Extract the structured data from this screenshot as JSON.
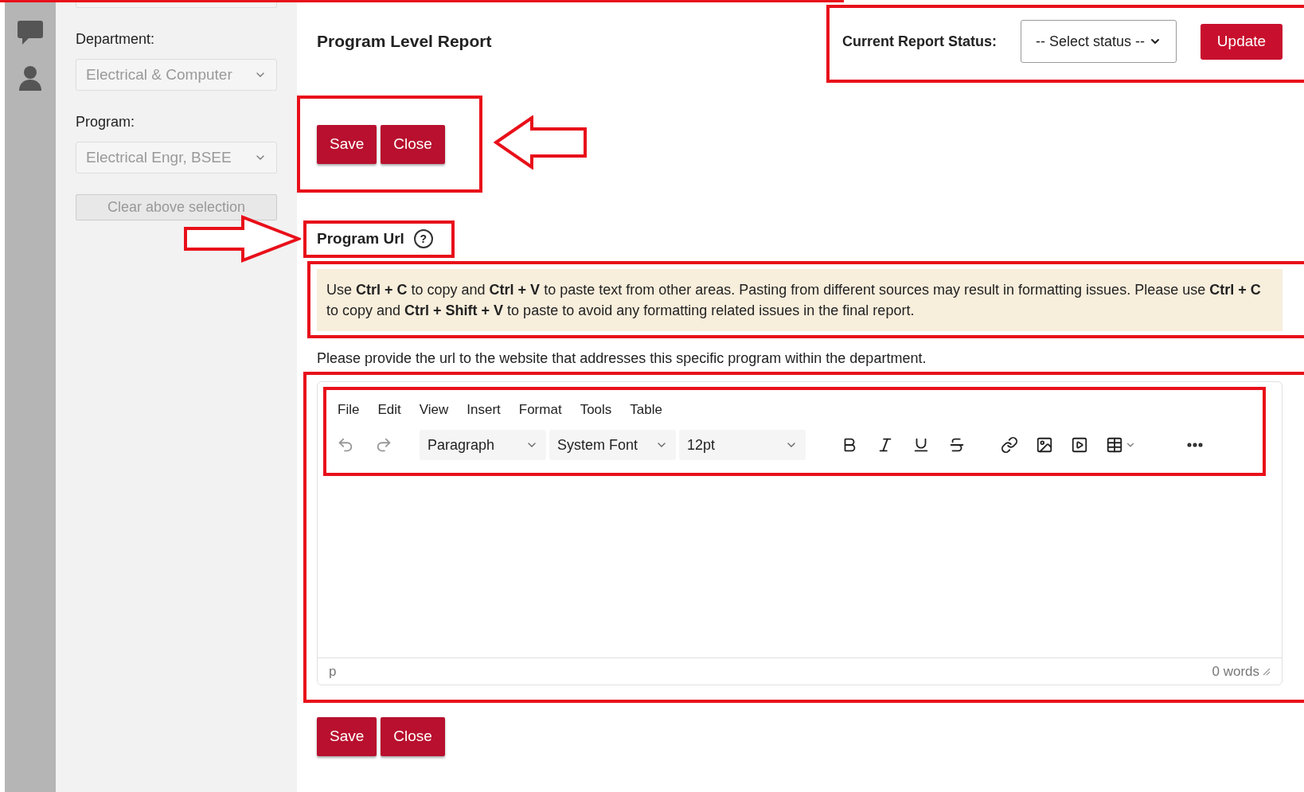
{
  "sidebar": {
    "fields": [
      {
        "label": "Department:",
        "value": "Electrical & Computer",
        "disabled": true
      },
      {
        "label": "Program:",
        "value": "Electrical Engr, BSEE",
        "disabled": true
      }
    ],
    "clear_button": {
      "label": "Clear above selection",
      "disabled": true
    }
  },
  "header": {
    "title": "Program Level Report",
    "status_label": "Current Report Status:",
    "status_select": "-- Select status --",
    "update_button": "Update"
  },
  "top_buttons": [
    "Save",
    "Close"
  ],
  "section": {
    "title": "Program Url",
    "help_icon": "?"
  },
  "notice": "Use **Ctrl + C** to copy and **Ctrl + V** to paste text from other areas. Pasting from different sources may result in formatting issues. Please use **Ctrl + C** to copy and **Ctrl + Shift + V** to paste to avoid any formatting related issues in the final report.",
  "instructions": "Please provide the url to the website that addresses this specific program within the department.",
  "editor": {
    "menu": [
      "File",
      "Edit",
      "View",
      "Insert",
      "Format",
      "Tools",
      "Table"
    ],
    "block_format": "Paragraph",
    "font": "System Font",
    "font_size": "12pt",
    "path": "p",
    "word_count": "0 words"
  },
  "bottom_buttons": [
    "Save",
    "Close"
  ]
}
